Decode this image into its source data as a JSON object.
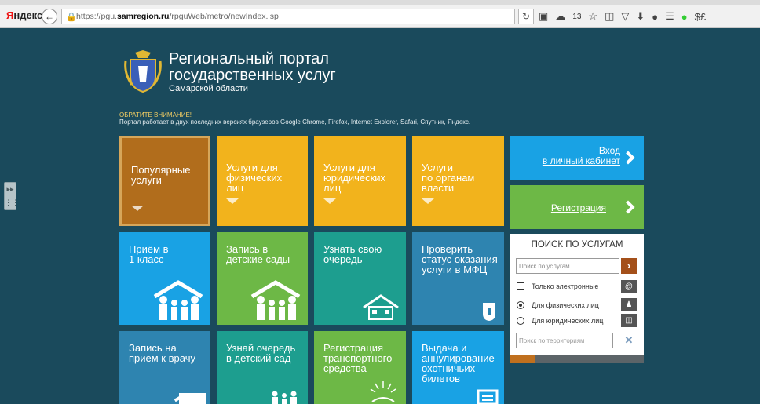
{
  "browser": {
    "brand_ya": "Я",
    "brand_rest": "ндекс",
    "back_icon": "←",
    "url_prefix": "https://pgu.",
    "url_domain": "samregion.ru",
    "url_path": "/rpguWeb/metro/newIndex.jsp",
    "weather": "13"
  },
  "header": {
    "title_line1": "Региональный портал",
    "title_line2": "государственных услуг",
    "subtitle": "Самарской области",
    "notice_title": "ОБРАТИТЕ ВНИМАНИЕ!",
    "notice_text": "Портал работает в двух последних версиях браузеров Google Chrome, Firefox, Internet Explorer, Safari, Спутник, Яндекс."
  },
  "tiles": {
    "popular": [
      "Популярные",
      "услуги"
    ],
    "physical": [
      "Услуги для",
      "физических",
      "лиц"
    ],
    "juridical": [
      "Услуги для",
      "юридических",
      "лиц"
    ],
    "organs": [
      "Услуги",
      "по органам",
      "власти"
    ],
    "school": [
      "Приём в",
      "1 класс"
    ],
    "kindergarten": [
      "Запись в",
      "детские сады"
    ],
    "queue": [
      "Узнать свою",
      "очередь"
    ],
    "mfc": [
      "Проверить",
      "статус оказания",
      "услуги в МФЦ"
    ],
    "doctor": [
      "Запись на",
      "прием к врачу"
    ],
    "kinder_queue": [
      "Узнай очередь",
      "в детский сад"
    ],
    "vehicle": [
      "Регистрация",
      "транспортного",
      "средства"
    ],
    "hunting": [
      "Выдача и",
      "аннулирование",
      "охотничьих",
      "билетов"
    ]
  },
  "account": {
    "login_line1": "Вход",
    "login_line2": "в личный кабинет",
    "register": "Регистрация"
  },
  "search": {
    "title": "ПОИСК ПО УСЛУГАМ",
    "placeholder": "Поиск по услугам",
    "only_electronic": "Только электронные",
    "for_physical": "Для физических лиц",
    "for_juridical": "Для юридических лиц",
    "territory_placeholder": "Поиск по территориям"
  },
  "colors": {
    "background": "#1a4a5c",
    "orange": "#f2b31c",
    "blue": "#19a2e4",
    "green": "#6db846",
    "teal": "#1d9e8f",
    "dark_blue": "#2e84b0",
    "brown": "#b16d1c"
  }
}
